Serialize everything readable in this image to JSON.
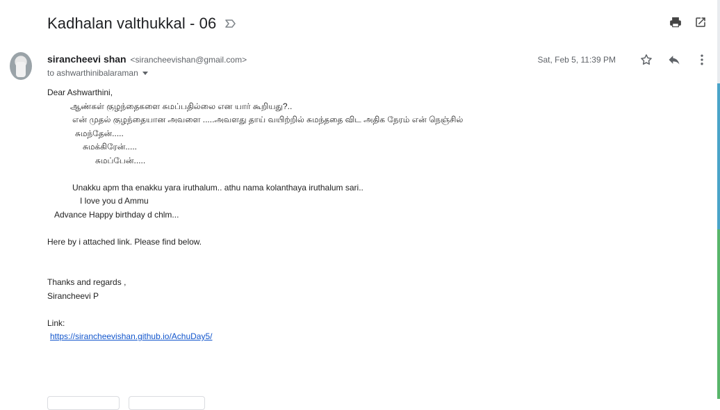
{
  "email": {
    "subject": "Kadhalan valthukkal - 06",
    "sender_name": "sirancheevi shan",
    "sender_email": "<sirancheevishan@gmail.com>",
    "to_line": "to ashwarthinibalaraman",
    "date": "Sat, Feb 5, 11:39 PM"
  },
  "body_lines": [
    "Dear Ashwarthini,",
    "ஆண்கள் குழந்தைகளை சுமப்பதில்லை என யார் கூறியது?..",
    "என் முதல் குழந்தையான அவளை .....அவளது தாய் வயிற்றில் சுமந்ததை விட அதிக நேரம் என் நெஞ்சில்",
    "சுமந்தேன்.....",
    "சுமக்கிரேன்.....",
    "சுமப்பேன்.....",
    "Unakku apm tha enakku yara iruthalum.. athu nama kolanthaya iruthalum sari..",
    "I love you d Ammu",
    "Advance Happy birthday d chlm...",
    "Here by i attached link. Please find below.",
    "Thanks and regards ,",
    "Sirancheevi P",
    "Link:",
    "https://sirancheevishan.github.io/AchuDay5/"
  ],
  "icons": {
    "label": "label-important-icon",
    "print": "print-icon",
    "open_new": "open-in-new-window-icon",
    "star": "star-icon",
    "reply": "reply-icon",
    "more": "more-vert-icon"
  },
  "colors": {
    "link": "#1155cc",
    "meta": "#5f6368",
    "subject": "#202124"
  }
}
